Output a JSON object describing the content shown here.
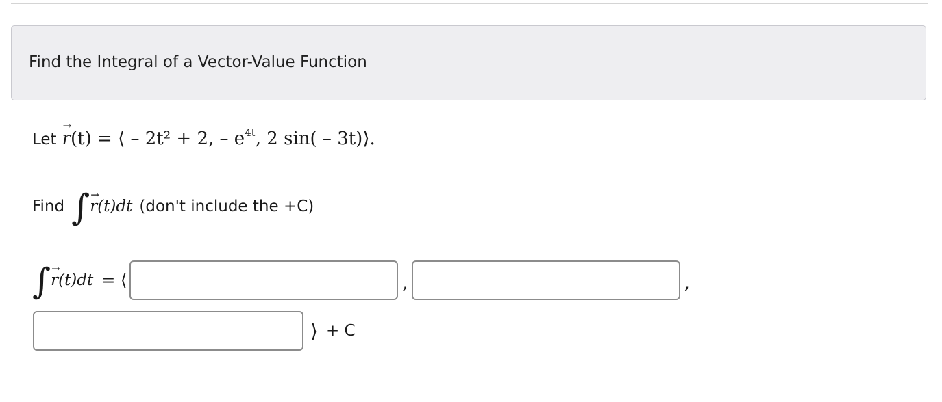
{
  "header": {
    "title": "Find the Integral of a Vector-Value Function"
  },
  "problem": {
    "let_word": "Let",
    "r_letter": "r",
    "vector_arrow": "⃗",
    "function_def": "(t) = ⟨ – 2t² + 2,  – e",
    "exp_power": "4t",
    "function_tail": ", 2 sin( – 3t)⟩.",
    "find_word": "Find",
    "integral_body": "(t)dt",
    "find_note": "(don't include the +C)"
  },
  "answer": {
    "integral_body": "(t)dt",
    "equals_open": "= ⟨",
    "comma": ",",
    "close_angle": "⟩",
    "plus_c": "+ C",
    "inputs": [
      {
        "value": "",
        "placeholder": ""
      },
      {
        "value": "",
        "placeholder": ""
      },
      {
        "value": "",
        "placeholder": ""
      }
    ]
  }
}
